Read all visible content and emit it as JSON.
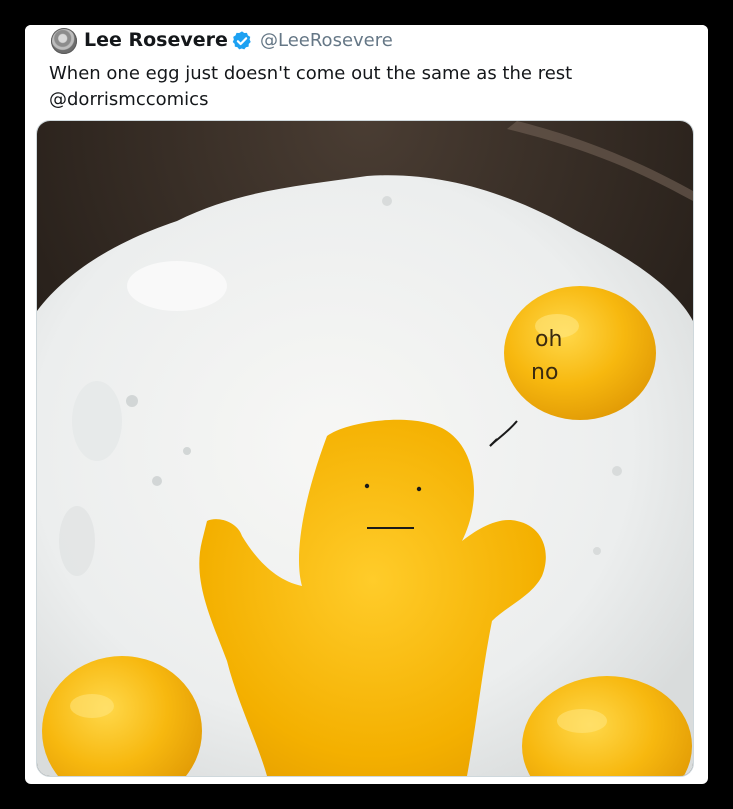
{
  "tweet": {
    "author_name": "Lee Rosevere",
    "author_handle": "@LeeRosevere",
    "text_line1": "When one egg just doesn't come out the same as the rest",
    "text_line2": "@dorrismccomics",
    "verified": true
  },
  "photo": {
    "speech_text_line1": "oh",
    "speech_text_line2": "no"
  },
  "colors": {
    "verified_badge": "#1da1f2",
    "yolk": "#f6b40c",
    "egg_white": "#f4f4f2",
    "pan": "#2b241f"
  }
}
